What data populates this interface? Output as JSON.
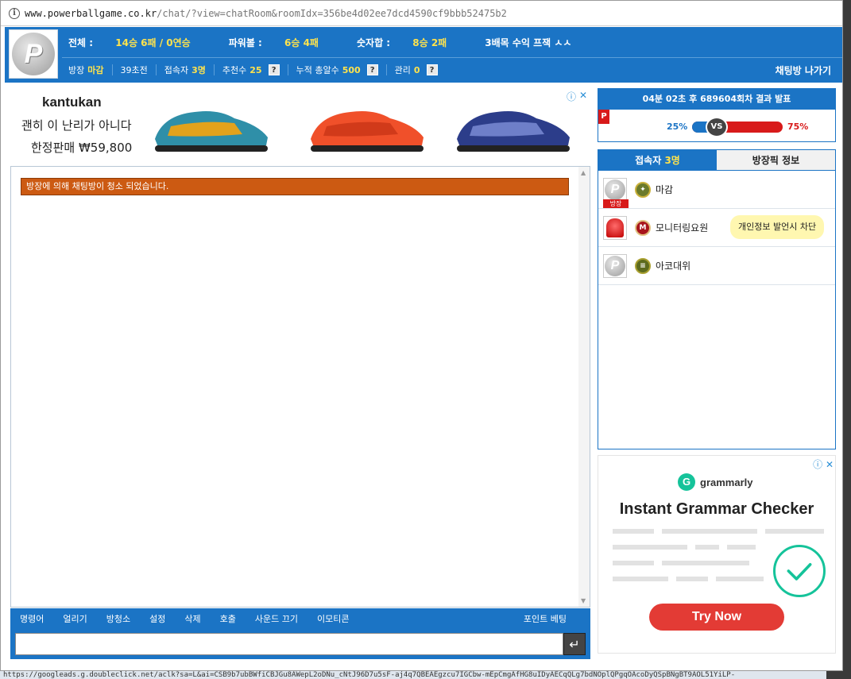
{
  "address_bar": {
    "host": "www.powerballgame.co.kr",
    "path": "/chat/?view=chatRoom&roomIdx=356be4d02ee7dcd4590cf9bbb52475b2"
  },
  "header": {
    "stats": {
      "total_label": "전체 : ",
      "total_value": "14승 6패 / 0연승",
      "powerball_label": "파워볼 : ",
      "powerball_value": "6승 4패",
      "sum_label": "숫자합 : ",
      "sum_value": "8승 2패",
      "title_text": "3배목 수익 프잭 ㅅㅅ"
    },
    "info": {
      "room_label": "방장",
      "room_value": "마감",
      "time_text": "39초전",
      "users_label": "접속자",
      "users_value": "3명",
      "recommend_label": "추천수",
      "recommend_value": "25",
      "bullets_label": "누적 총알수",
      "bullets_value": "500",
      "manage_label": "관리",
      "manage_value": "0",
      "help": "?"
    },
    "exit_label": "채팅방 나가기"
  },
  "ad_top": {
    "brand": "kantukan",
    "line1": "괜히 이 난리가 아니다",
    "line2": "한정판매 ₩59,800"
  },
  "chat": {
    "notice": "방장에 의해 채팅방이 청소 되었습니다.",
    "toolbar": [
      "명령어",
      "얼리기",
      "방청소",
      "설정",
      "삭제",
      "호출",
      "사운드 끄기",
      "이모티콘"
    ],
    "toolbar_right": "포인트 베팅",
    "input_value": "",
    "send_icon": "↵"
  },
  "result": {
    "title": "04분 02초 후 689604회차 결과 발표",
    "left_pct": "25%",
    "right_pct": "75%",
    "left_fraction": 0.25,
    "vs": "VS",
    "flag": "P"
  },
  "users": {
    "tab_users_label": "접속자",
    "tab_users_count": "3명",
    "tab_pick_label": "방장픽 정보",
    "list": [
      {
        "name": "마감",
        "badge": "방장"
      },
      {
        "name": "모니터링요원",
        "tooltip": "개인정보 발언시 차단"
      },
      {
        "name": "아코대위"
      }
    ]
  },
  "ad_right": {
    "brand": "grammarly",
    "headline": "Instant Grammar Checker",
    "cta": "Try Now"
  },
  "statusbar": "https://googleads.g.doubleclick.net/aclk?sa=L&ai=CSB9b7ubBWfiCBJGu8AWepL2oDNu_cNtJ96D7u5sF-aj4q7QBEAEgzcu7IGCbw-mEpCmgAfHG8uIDyAECqQLg7bdNOplQPgqOAcoDyQSpBNgBT9AOL51YiLP-"
}
